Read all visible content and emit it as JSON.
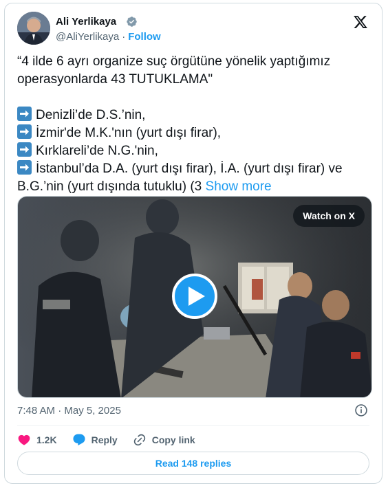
{
  "author": {
    "display_name": "Ali Yerlikaya",
    "handle": "@AliYerlikaya",
    "separator": "·",
    "follow_label": "Follow",
    "verified": true
  },
  "tweet": {
    "lines": [
      "“4 ilde 6 ayrı organize suç örgütüne yönelik yaptığımız",
      "operasyonlarda 43 TUTUKLAMA\""
    ],
    "bullets": [
      "Denizli’de D.S.’nin,",
      "İzmir'de M.K.'nın (yurt dışı firar),",
      "Kırklareli’de N.G.'nin,",
      "İstanbul’da D.A. (yurt dışı firar), İ.A. (yurt dışı firar) ve"
    ],
    "last_line": "B.G.’nin (yurt dışında tutuklu) (3",
    "show_more": "Show more"
  },
  "media": {
    "watch_label": "Watch on X"
  },
  "timestamp": "7:48 AM · May 5, 2025",
  "actions": {
    "likes": "1.2K",
    "reply_label": "Reply",
    "copy_label": "Copy link"
  },
  "read_replies_label": "Read 148 replies",
  "colors": {
    "accent": "#1d9bf0",
    "like": "#f91880",
    "arrow_emoji": "#3b88c3"
  },
  "icons": [
    "verified-badge-icon",
    "x-logo-icon",
    "arrow-right-icon",
    "play-icon",
    "info-icon",
    "heart-icon",
    "reply-icon",
    "link-icon"
  ]
}
